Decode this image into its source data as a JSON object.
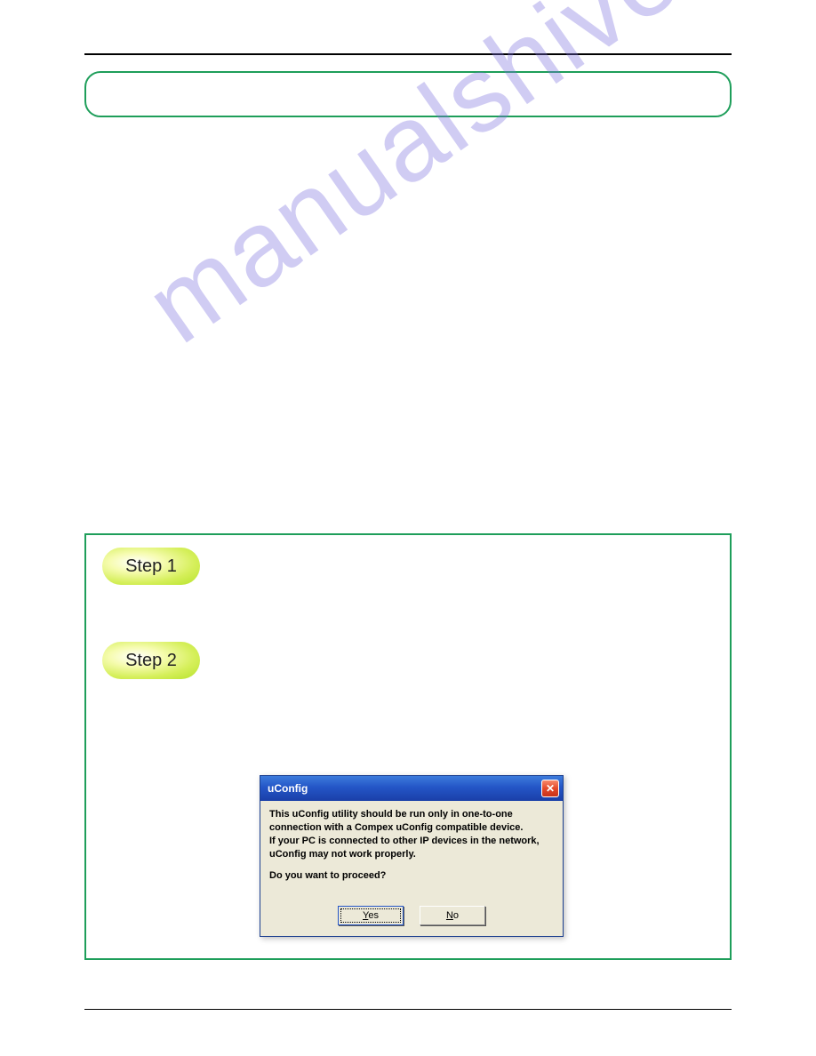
{
  "watermark": "manualshive.com",
  "steps": {
    "step1_label": "Step 1",
    "step2_label": "Step 2"
  },
  "dialog": {
    "title": "uConfig",
    "line1": "This uConfig utility should be run only in one-to-one",
    "line2": "connection with a Compex uConfig compatible device.",
    "line3": "If your PC is connected to other IP devices in the network,",
    "line4": "uConfig may not work properly.",
    "prompt": "Do you want to proceed?",
    "yes_prefix": "Y",
    "yes_suffix": "es",
    "no_prefix": "N",
    "no_suffix": "o",
    "close_glyph": "✕"
  }
}
